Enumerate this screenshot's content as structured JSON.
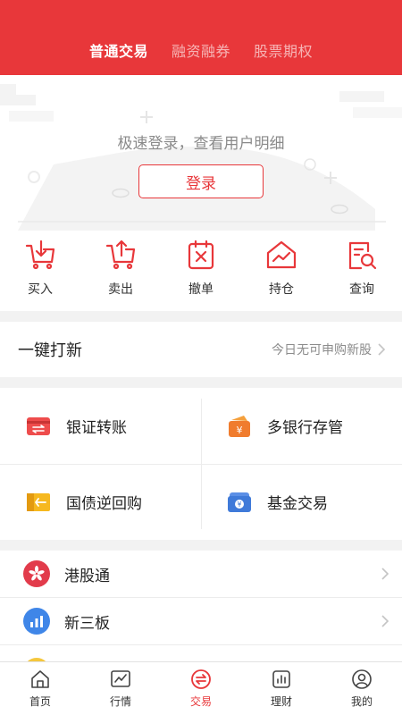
{
  "colors": {
    "brand": "#e8373a",
    "text": "#222222",
    "muted": "#8c8c8c"
  },
  "header": {
    "tabs": [
      {
        "label": "普通交易",
        "active": true
      },
      {
        "label": "融资融券",
        "active": false
      },
      {
        "label": "股票期权",
        "active": false
      }
    ]
  },
  "login": {
    "hint": "极速登录，查看用户明细",
    "button": "登录"
  },
  "actions": [
    {
      "label": "买入",
      "icon": "cart-in-icon"
    },
    {
      "label": "卖出",
      "icon": "cart-out-icon"
    },
    {
      "label": "撤单",
      "icon": "cancel-order-icon"
    },
    {
      "label": "持仓",
      "icon": "holdings-icon"
    },
    {
      "label": "查询",
      "icon": "query-icon"
    }
  ],
  "ipo": {
    "title": "一键打新",
    "status": "今日无可申购新股"
  },
  "grid": [
    {
      "label": "银证转账",
      "icon": "bank-transfer-icon"
    },
    {
      "label": "多银行存管",
      "icon": "multi-bank-icon"
    },
    {
      "label": "国债逆回购",
      "icon": "treasury-repo-icon"
    },
    {
      "label": "基金交易",
      "icon": "fund-icon"
    }
  ],
  "list": [
    {
      "label": "港股通",
      "icon": "hk-connect-icon"
    },
    {
      "label": "新三板",
      "icon": "neeq-icon"
    }
  ],
  "nav": [
    {
      "label": "首页",
      "icon": "home-icon",
      "active": false
    },
    {
      "label": "行情",
      "icon": "market-icon",
      "active": false
    },
    {
      "label": "交易",
      "icon": "trade-icon",
      "active": true
    },
    {
      "label": "理财",
      "icon": "finance-icon",
      "active": false
    },
    {
      "label": "我的",
      "icon": "profile-icon",
      "active": false
    }
  ]
}
